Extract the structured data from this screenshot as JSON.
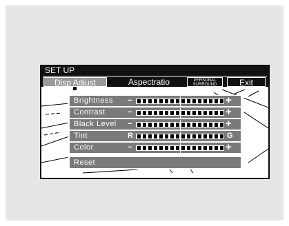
{
  "menu_title": "SET UP",
  "tabs": [
    {
      "label": "Disp Adjust"
    },
    {
      "label": "Aspectratio"
    },
    {
      "label_line1": "PERSONAL",
      "label_line2": "SURROUND"
    },
    {
      "label": "Exit"
    }
  ],
  "adjust_rows": [
    {
      "label": "Brightness",
      "left_symbol": "−",
      "right_symbol": "+",
      "level": 0.5
    },
    {
      "label": "Contrast",
      "left_symbol": "−",
      "right_symbol": "+",
      "level": 0.5
    },
    {
      "label": "Black Level",
      "left_symbol": "−",
      "right_symbol": "+",
      "level": 0.5
    },
    {
      "label": "Tint",
      "left_symbol": "R",
      "right_symbol": "G",
      "level": 0.5
    },
    {
      "label": "Color",
      "left_symbol": "−",
      "right_symbol": "+",
      "level": 0.5
    }
  ],
  "reset_label": "Reset"
}
